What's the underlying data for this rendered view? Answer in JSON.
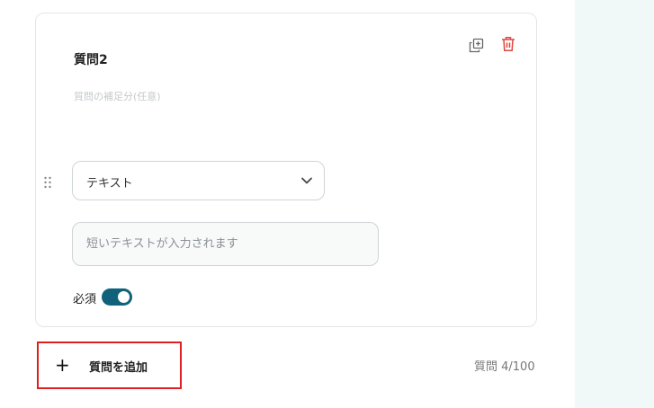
{
  "question": {
    "title": "質問2",
    "description_placeholder": "質問の補足分(任意)",
    "type_select": {
      "value": "テキスト"
    },
    "answer_input": {
      "placeholder": "短いテキストが入力されます",
      "value": ""
    },
    "required": {
      "label": "必須",
      "enabled": true
    }
  },
  "footer": {
    "add_question_plus": "+",
    "add_question_label": "質問を追加",
    "question_counter": "質問 4/100"
  },
  "icons": {
    "copy": "copy-icon",
    "delete": "trash-icon",
    "drag": "drag-handle-icon",
    "chevron": "chevron-down-icon"
  },
  "colors": {
    "toggle_on": "#10627a",
    "delete_icon": "#e0453e",
    "highlight_border": "#e02020",
    "side_panel": "#f1f8f8"
  }
}
